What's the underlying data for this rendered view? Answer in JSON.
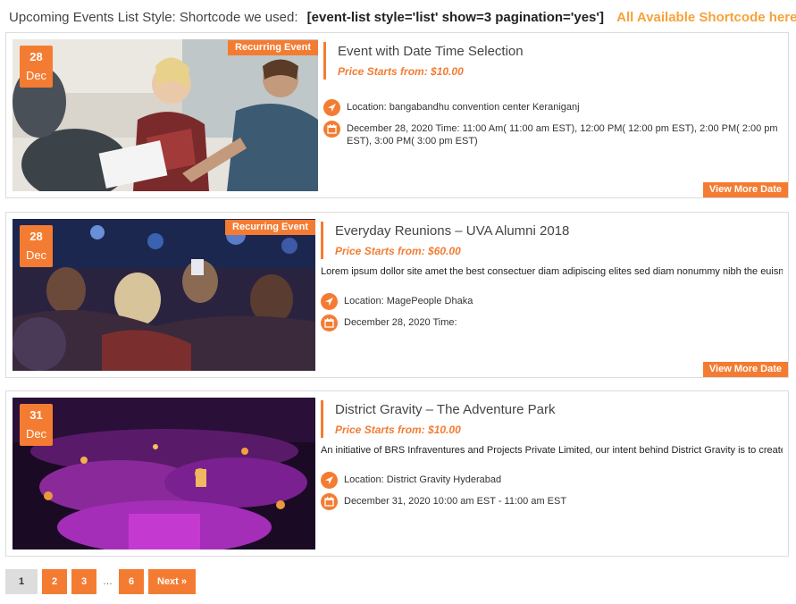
{
  "header": {
    "label": "Upcoming Events List Style:  Shortcode we used:",
    "shortcode": "[event-list style='list' show=3 pagination='yes']",
    "link": "All Available Shortcode here"
  },
  "events": [
    {
      "day": "28",
      "month": "Dec",
      "badge": "Recurring Event",
      "title": "Event with Date Time Selection",
      "price": "Price Starts from: $10.00",
      "location_label": "Location:",
      "location": "bangabandhu convention center Keraniganj",
      "datetime": "December 28, 2020 Time:  11:00 Am( 11:00 am EST), 12:00 PM( 12:00 pm EST), 2:00 PM( 2:00 pm EST), 3:00 PM( 3:00 pm EST)",
      "more": "View More Date"
    },
    {
      "day": "28",
      "month": "Dec",
      "badge": "Recurring Event",
      "title": "Everyday Reunions – UVA Alumni 2018",
      "price": "Price Starts from: $60.00",
      "description": "Lorem ipsum dollor site amet the best consectuer diam adipiscing elites sed diam nonummy nibh the euismod tincidunt",
      "location_label": "Location:",
      "location": "MagePeople Dhaka",
      "datetime": "December 28, 2020 Time:",
      "more": "View More Date"
    },
    {
      "day": "31",
      "month": "Dec",
      "title": "District Gravity – The Adventure Park",
      "price": "Price Starts from: $10.00",
      "description": "An initiative of BRS Infraventures and Projects Private Limited, our intent behind District Gravity is to create a destination",
      "location_label": "Location:",
      "location": "District Gravity Hyderabad",
      "datetime": "December 31, 2020  10:00 am EST - 11:00 am EST"
    }
  ],
  "pagination": {
    "pages": [
      "1",
      "2",
      "3"
    ],
    "ellipsis": "…",
    "last": "6",
    "next": "Next »",
    "current": "1"
  },
  "colors": {
    "accent": "#f47c32",
    "link": "#f7a23b"
  },
  "icons": {
    "location": "location-arrow-icon",
    "date": "calendar-icon"
  }
}
